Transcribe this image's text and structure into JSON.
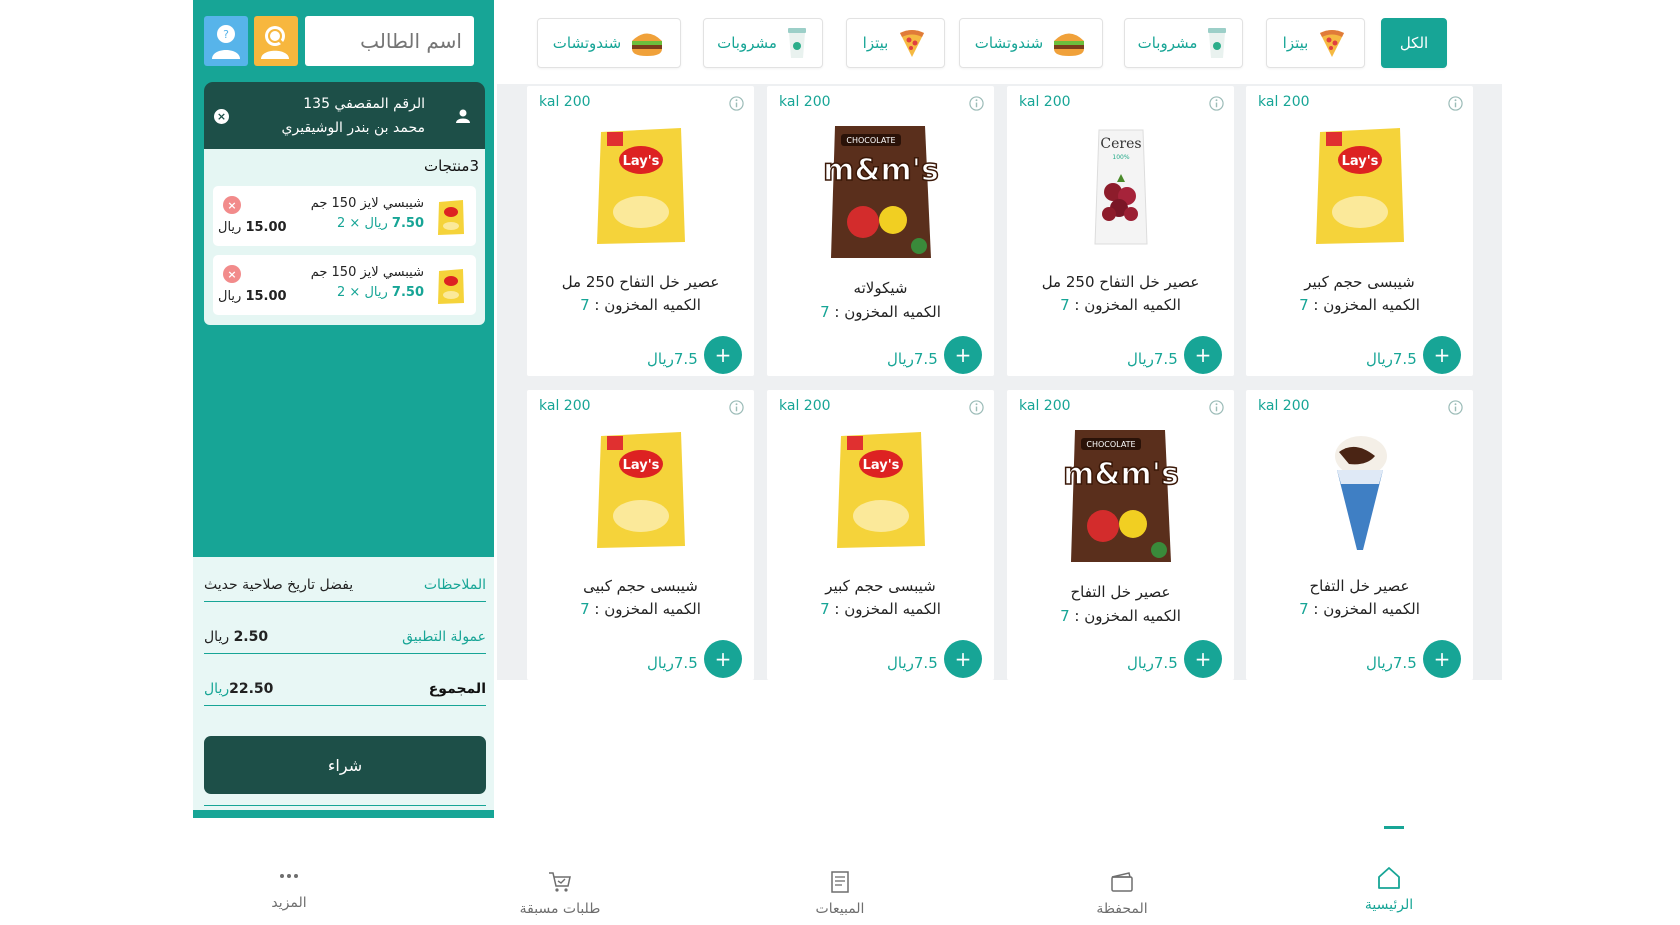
{
  "colors": {
    "primary": "#17a596",
    "dark": "#1d4f48",
    "help": "#57b4ea",
    "search": "#f7b73e",
    "remove": "#f28b8b"
  },
  "sidebar": {
    "search_placeholder": "اسم الطالب",
    "help_icon": "user-help-icon",
    "search_icon": "user-search-icon",
    "customer": {
      "id_text": "الرقم المقصفي 135",
      "name": "محمد بن بندر الوشيقيري",
      "close": "×"
    },
    "cart": {
      "count_text": "3منتجات",
      "items": [
        {
          "name": "شيبسي لايز 150 جم",
          "unit_price": "7.50",
          "currency": "ريال",
          "qty_text": "× 2",
          "total": "15.00",
          "remove": "×"
        },
        {
          "name": "شيبسي لايز 150 جم",
          "unit_price": "7.50",
          "currency": "ريال",
          "qty_text": "× 2",
          "total": "15.00",
          "remove": "×"
        }
      ]
    },
    "summary": {
      "notes_label": "الملاحظات",
      "notes_value": "يفضل تاريخ صلاحية حديث",
      "fee_label": "عمولة التطبيق",
      "fee_value": "2.50",
      "fee_currency": "ريال",
      "total_label": "المجموع",
      "total_value": "22.50",
      "total_currency": "ريال",
      "buy_label": "شراء"
    }
  },
  "categories": [
    {
      "label": "الكل",
      "icon": "",
      "active": true
    },
    {
      "label": "بيتزا",
      "icon": "pizza-icon"
    },
    {
      "label": "مشروبات",
      "icon": "drink-cup-icon"
    },
    {
      "label": "شندوتشات",
      "icon": "burger-icon"
    },
    {
      "label": "بيتزا",
      "icon": "pizza-icon"
    },
    {
      "label": "مشروبات",
      "icon": "drink-cup-icon"
    },
    {
      "label": "شندوتشات",
      "icon": "burger-icon"
    }
  ],
  "products": [
    {
      "kal": "kal 200",
      "name": "شيبسى حجم كبير",
      "stock_label": "الكميه المخزون :",
      "stock": "7",
      "price": "7.5ريال",
      "image": "chips-bag-icon"
    },
    {
      "kal": "kal 200",
      "name": "عصير خل التفاح 250 مل",
      "stock_label": "الكميه المخزون :",
      "stock": "7",
      "price": "7.5ريال",
      "image": "juice-box-icon"
    },
    {
      "kal": "kal 200",
      "name": "شيكولاته",
      "stock_label": "الكميه المخزون :",
      "stock": "7",
      "price": "7.5ريال",
      "image": "chocolate-bag-icon"
    },
    {
      "kal": "kal 200",
      "name": "عصير خل التفاح 250 مل",
      "stock_label": "الكميه المخزون :",
      "stock": "7",
      "price": "7.5ريال",
      "image": "chips-bag-icon"
    },
    {
      "kal": "kal 200",
      "name": "عصير خل التفاح",
      "stock_label": "الكميه المخزون :",
      "stock": "7",
      "price": "7.5ريال",
      "image": "ice-cream-cone-icon"
    },
    {
      "kal": "kal 200",
      "name": "عصير خل التفاح",
      "stock_label": "الكميه المخزون :",
      "stock": "7",
      "price": "7.5ريال",
      "image": "chocolate-bag-icon"
    },
    {
      "kal": "kal 200",
      "name": "شيبسى حجم كبير",
      "stock_label": "الكميه المخزون :",
      "stock": "7",
      "price": "7.5ريال",
      "image": "chips-bag-icon"
    },
    {
      "kal": "kal 200",
      "name": "شيبسى حجم كبيى",
      "stock_label": "الكميه المخزون :",
      "stock": "7",
      "price": "7.5ريال",
      "image": "chips-bag-icon"
    }
  ],
  "add_label": "+",
  "nav": [
    {
      "label": "الرئيسية",
      "icon": "home-icon",
      "active": true
    },
    {
      "label": "المحفظة",
      "icon": "wallet-icon"
    },
    {
      "label": "المبيعات",
      "icon": "receipt-icon"
    },
    {
      "label": "طلبات مسبقة",
      "icon": "cart-check-icon"
    },
    {
      "label": "المزيد",
      "icon": "more-dots-icon"
    }
  ]
}
